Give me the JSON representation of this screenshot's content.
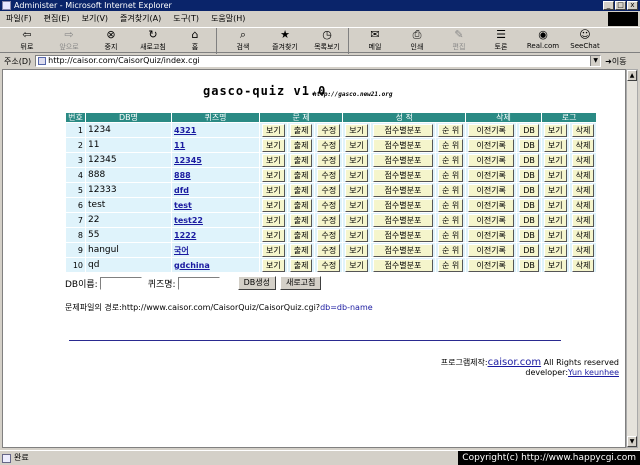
{
  "window": {
    "title": "Administer - Microsoft Internet Explorer",
    "controls": [
      "_",
      "□",
      "x"
    ]
  },
  "menu": [
    "파일(F)",
    "편집(E)",
    "보기(V)",
    "즐겨찾기(A)",
    "도구(T)",
    "도움말(H)"
  ],
  "toolbar": {
    "back": "뒤로",
    "forward": "앞으로",
    "stop": "중지",
    "refresh": "새로고침",
    "home": "홈",
    "search": "검색",
    "favorites": "즐겨찾기",
    "history": "목록보기",
    "mail": "메일",
    "print": "인쇄",
    "edit": "편집",
    "discuss": "토론",
    "realcom": "Real.com",
    "seechat": "SeeChat"
  },
  "address": {
    "label": "주소(D)",
    "url": "http://caisor.com/CaisorQuiz/index.cgi",
    "go": "이동"
  },
  "page": {
    "title": "gasco-quiz  v1.0",
    "site": "http://gasco.new21.org"
  },
  "table": {
    "headers": {
      "num": "번호",
      "db": "DB명",
      "quiz": "퀴즈명",
      "problem": "문 제",
      "score": "성 적",
      "delete": "삭제",
      "log": "로그"
    },
    "buttons": {
      "view": "보기",
      "make": "출제",
      "edit": "수정",
      "dist": "점수별분포",
      "rank": "순 위",
      "prev": "이전기록",
      "db": "DB",
      "del": "삭제"
    },
    "rows": [
      {
        "num": "1",
        "db": "1234",
        "quiz": "4321"
      },
      {
        "num": "2",
        "db": "11",
        "quiz": "11"
      },
      {
        "num": "3",
        "db": "12345",
        "quiz": "12345"
      },
      {
        "num": "4",
        "db": "888",
        "quiz": "888"
      },
      {
        "num": "5",
        "db": "12333",
        "quiz": "dfd"
      },
      {
        "num": "6",
        "db": "test",
        "quiz": "test"
      },
      {
        "num": "7",
        "db": "22",
        "quiz": "test22"
      },
      {
        "num": "8",
        "db": "55",
        "quiz": "1222"
      },
      {
        "num": "9",
        "db": "hangul",
        "quiz": "국어"
      },
      {
        "num": "10",
        "db": "qd",
        "quiz": "gdchina"
      }
    ]
  },
  "form": {
    "db_label": "DB이름:",
    "quiz_label": "퀴즈명:",
    "create": "DB생성",
    "reload": "새로고침"
  },
  "path": {
    "prefix": "문제파일의 경로:http://www.caisor.com/CaisorQuiz/CaisorQuiz.cgi?",
    "suffix": "db=db-name"
  },
  "credits": {
    "made_by": "프로그램제작:",
    "site": "caisor.com",
    "rights": " All Rights reserved",
    "dev_label": "developer:",
    "developer": "Yun keunhee"
  },
  "status": {
    "text": "완료",
    "copyright": "Copyright(c) http://www.happycgi.com"
  }
}
